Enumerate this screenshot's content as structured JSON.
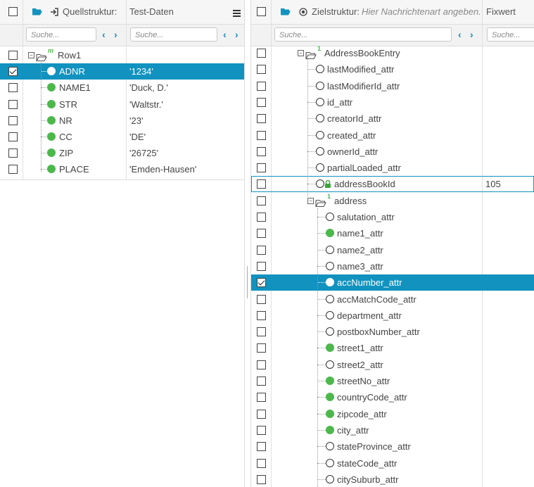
{
  "left": {
    "header": {
      "source_label": "Quellstruktur:",
      "data_label": "Test-Daten"
    },
    "search": {
      "placeholder": "Suche...",
      "data_placeholder": "Suche..."
    },
    "rows": [
      {
        "name": "Row1",
        "value": "",
        "checked": false
      },
      {
        "name": "ADNR",
        "value": "'1234'",
        "checked": true
      },
      {
        "name": "NAME1",
        "value": "'Duck, D.'",
        "checked": false
      },
      {
        "name": "STR",
        "value": "'Waltstr.'",
        "checked": false
      },
      {
        "name": "NR",
        "value": "'23'",
        "checked": false
      },
      {
        "name": "CC",
        "value": "'DE'",
        "checked": false
      },
      {
        "name": "ZIP",
        "value": "'26725'",
        "checked": false
      },
      {
        "name": "PLACE",
        "value": "'Emden-Hausen'",
        "checked": false
      }
    ],
    "root_marker": "m"
  },
  "right": {
    "header": {
      "target_label": "Zielstruktur:",
      "message_type_hint": "Hier Nachrichtenart angeben.",
      "fixed_label": "Fixwert"
    },
    "search": {
      "placeholder": "Suche...",
      "fixed_placeholder": "Suche..."
    },
    "rows": [
      {
        "name": "AddressBookEntry",
        "fixed": "",
        "checked": false
      },
      {
        "name": "lastModified_attr",
        "fixed": "",
        "checked": false
      },
      {
        "name": "lastModifierId_attr",
        "fixed": "",
        "checked": false
      },
      {
        "name": "id_attr",
        "fixed": "",
        "checked": false
      },
      {
        "name": "creatorId_attr",
        "fixed": "",
        "checked": false
      },
      {
        "name": "created_attr",
        "fixed": "",
        "checked": false
      },
      {
        "name": "ownerId_attr",
        "fixed": "",
        "checked": false
      },
      {
        "name": "partialLoaded_attr",
        "fixed": "",
        "checked": false
      },
      {
        "name": "addressBookId",
        "fixed": "105",
        "checked": false
      },
      {
        "name": "address",
        "fixed": "",
        "checked": false
      },
      {
        "name": "salutation_attr",
        "fixed": "",
        "checked": false
      },
      {
        "name": "name1_attr",
        "fixed": "",
        "checked": false
      },
      {
        "name": "name2_attr",
        "fixed": "",
        "checked": false
      },
      {
        "name": "name3_attr",
        "fixed": "",
        "checked": false
      },
      {
        "name": "accNumber_attr",
        "fixed": "",
        "checked": true
      },
      {
        "name": "accMatchCode_attr",
        "fixed": "",
        "checked": false
      },
      {
        "name": "department_attr",
        "fixed": "",
        "checked": false
      },
      {
        "name": "postboxNumber_attr",
        "fixed": "",
        "checked": false
      },
      {
        "name": "street1_attr",
        "fixed": "",
        "checked": false
      },
      {
        "name": "street2_attr",
        "fixed": "",
        "checked": false
      },
      {
        "name": "streetNo_attr",
        "fixed": "",
        "checked": false
      },
      {
        "name": "countryCode_attr",
        "fixed": "",
        "checked": false
      },
      {
        "name": "zipcode_attr",
        "fixed": "",
        "checked": false
      },
      {
        "name": "city_attr",
        "fixed": "",
        "checked": false
      },
      {
        "name": "stateProvince_attr",
        "fixed": "",
        "checked": false
      },
      {
        "name": "stateCode_attr",
        "fixed": "",
        "checked": false
      },
      {
        "name": "citySuburb_attr",
        "fixed": "",
        "checked": false
      }
    ],
    "level_marker": "1"
  },
  "colors": {
    "accent": "#1192bf",
    "mapped": "#4cb84c",
    "lock": "#3aa63a"
  }
}
